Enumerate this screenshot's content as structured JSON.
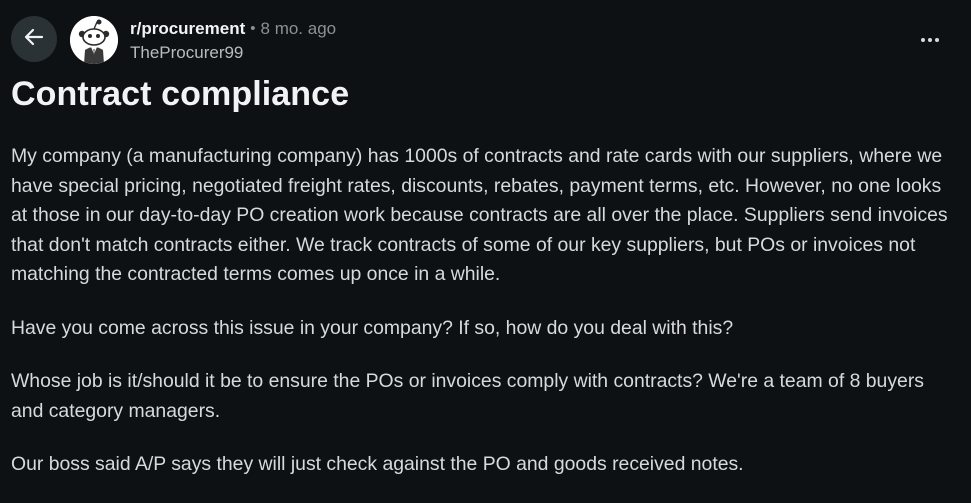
{
  "header": {
    "subreddit": "r/procurement",
    "separator": "•",
    "time": "8 mo. ago",
    "author": "TheProcurer99"
  },
  "icons": {
    "back": "arrow-left-icon",
    "avatar": "reddit-snoo-icon",
    "more": "more-horizontal-icon"
  },
  "colors": {
    "background": "#0e1113",
    "back_button_bg": "#2a3236",
    "text": "#d7dadc",
    "muted": "#8a9194"
  },
  "post": {
    "title": "Contract compliance",
    "paragraphs": [
      "My company (a manufacturing company) has 1000s of contracts and rate cards with our suppliers, where we have special pricing, negotiated freight rates, discounts, rebates, payment terms, etc. However, no one looks at those in our day-to-day PO creation work because contracts are all over the place. Suppliers send invoices that don't match contracts either. We track contracts of some of our key suppliers, but POs or invoices not matching the contracted terms comes up once in a while.",
      "Have you come across this issue in your company? If so, how do you deal with this?",
      "Whose job is it/should it be to ensure the POs or invoices comply with contracts? We're a team of 8 buyers and category managers.",
      "Our boss said A/P says they will just check against the PO and goods received notes."
    ]
  }
}
